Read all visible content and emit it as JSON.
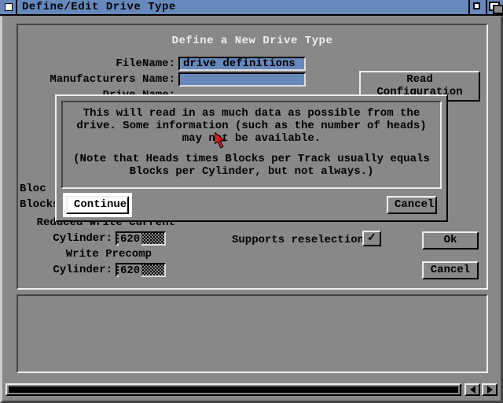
{
  "window": {
    "title": "Define/Edit Drive Type"
  },
  "panel": {
    "title": "Define a New Drive Type",
    "labels": {
      "filename": "FileName:",
      "mfr": "Manufacturers Name:",
      "drivename": "Drive Name:",
      "rwc": "Reduced Write Current",
      "cylinder": "Cylinder:",
      "writeprecomp": "Write Precomp",
      "supports": "Supports reselection",
      "bloc_partial": "Bloc",
      "blocks_partial": "Blocks"
    },
    "values": {
      "filename": "drive definitions",
      "mfr": "",
      "rwc_cyl": "620",
      "wp_cyl": "620",
      "reselection_checked": "✓"
    },
    "buttons": {
      "read_cfg": "Read Configuration",
      "ok": "Ok",
      "cancel": "Cancel"
    }
  },
  "dialog": {
    "msg1": "This will read in as much data as possible from the drive. Some information (such as the number of heads) may not be available.",
    "msg2": "(Note that Heads times Blocks per Track usually equals Blocks per Cylinder, but not always.)",
    "continue": "Continue",
    "cancel": "Cancel"
  }
}
